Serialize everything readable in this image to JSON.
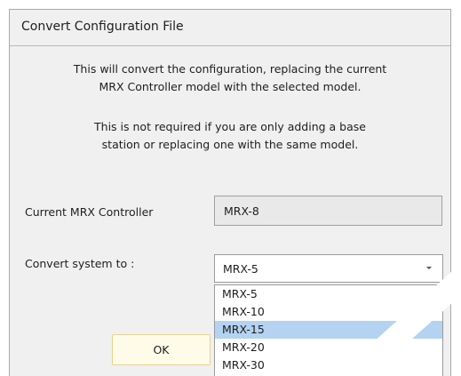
{
  "dialog": {
    "title": "Convert Configuration File",
    "message_1": [
      "This will convert the configuration, replacing the current",
      "MRX Controller model with the selected model."
    ],
    "message_2": [
      "This is not required if you are only adding a base",
      "station or replacing one with the same model."
    ],
    "current_controller": {
      "label": "Current MRX Controller",
      "value": "MRX-8"
    },
    "convert_to": {
      "label": "Convert system to :",
      "selected": "MRX-5",
      "options": [
        "MRX-5",
        "MRX-10",
        "MRX-15",
        "MRX-20",
        "MRX-30"
      ],
      "highlighted_option": "MRX-15"
    },
    "ok_label": "OK"
  },
  "colors": {
    "dialog_background": "#f0f0f0",
    "highlight": "#b3d3f0",
    "ok_button_fill": "#fffbe9",
    "ok_button_border": "#e9d38b"
  },
  "icons": {
    "dropdown": "chevron-down-icon"
  }
}
